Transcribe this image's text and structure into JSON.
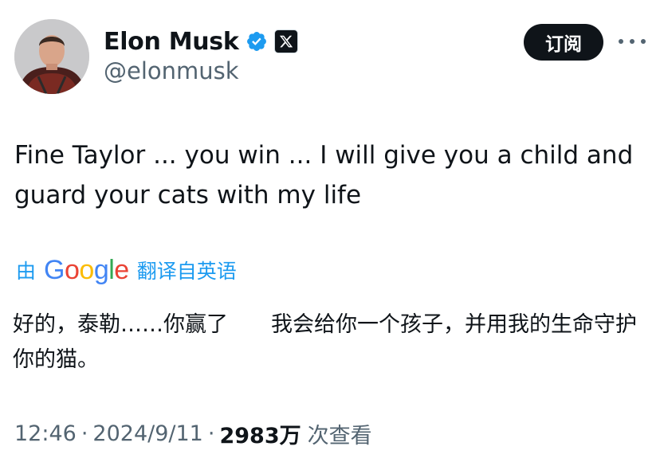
{
  "author": {
    "display_name": "Elon Musk",
    "handle": "@elonmusk",
    "verified_color": "#1d9bf0"
  },
  "header": {
    "subscribe_label": "订阅",
    "more_icon": "more-horizontal-icon"
  },
  "tweet": {
    "text": "Fine Taylor ... you win ... I will give you a child and guard your cats with my life"
  },
  "translation": {
    "prefix": "由",
    "brand_letters": [
      {
        "char": "G",
        "color": "#4285F4"
      },
      {
        "char": "o",
        "color": "#EA4335"
      },
      {
        "char": "o",
        "color": "#FBBC05"
      },
      {
        "char": "g",
        "color": "#4285F4"
      },
      {
        "char": "l",
        "color": "#34A853"
      },
      {
        "char": "e",
        "color": "#EA4335"
      }
    ],
    "suffix": "翻译自英语",
    "text": "好的，泰勒……你赢了　　我会给你一个孩子，并用我的生命守护你的猫。"
  },
  "meta": {
    "time": "12:46",
    "separator": "·",
    "date": "2024/9/11",
    "views_count": "2983万",
    "views_label": "次查看"
  }
}
